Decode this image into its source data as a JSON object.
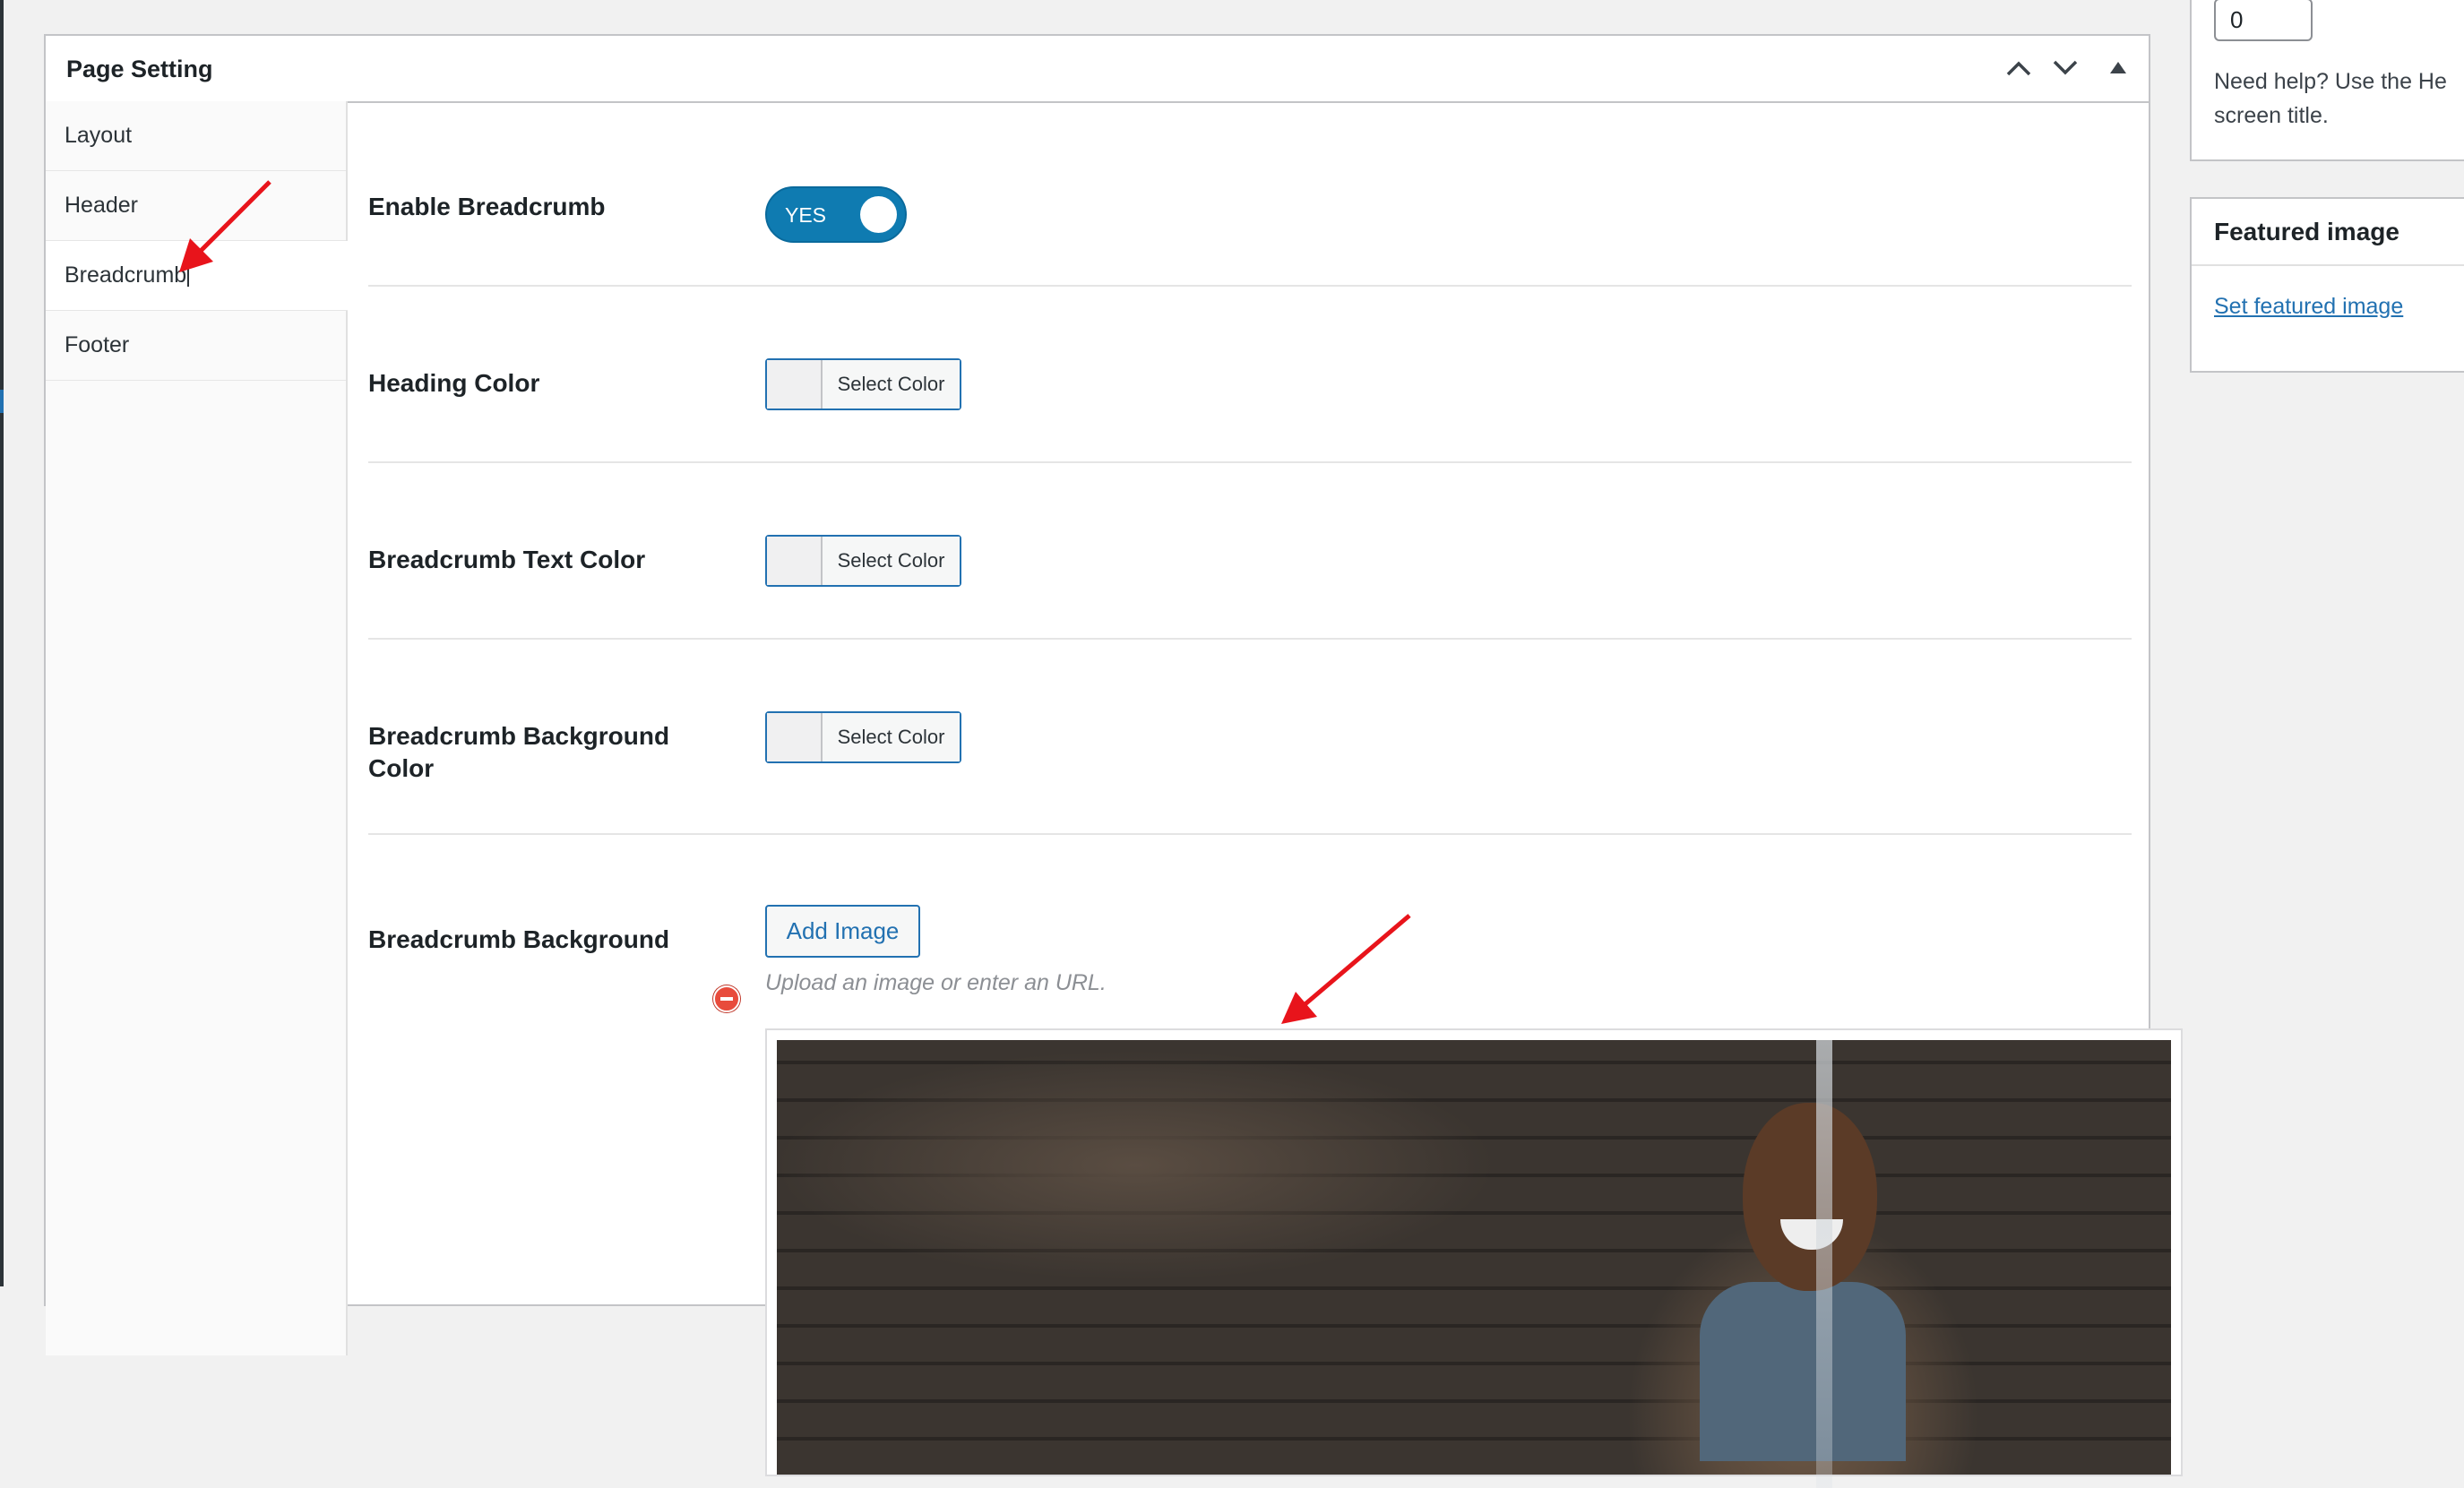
{
  "metabox": {
    "title": "Page Setting",
    "controls": [
      "chevron-up-icon",
      "chevron-down-icon",
      "triangle-up-icon"
    ]
  },
  "tabs": [
    {
      "label": "Layout"
    },
    {
      "label": "Header"
    },
    {
      "label": "Breadcrumb",
      "active": true
    },
    {
      "label": "Footer"
    }
  ],
  "fields": {
    "enable_breadcrumb": {
      "label": "Enable Breadcrumb",
      "toggle_text": "YES",
      "value": true
    },
    "heading_color": {
      "label": "Heading Color",
      "button": "Select Color"
    },
    "breadcrumb_text_color": {
      "label": "Breadcrumb Text Color",
      "button": "Select Color"
    },
    "breadcrumb_background_color": {
      "label": "Breadcrumb Background Color",
      "button": "Select Color"
    },
    "breadcrumb_background": {
      "label": "Breadcrumb Background",
      "add_button": "Add Image",
      "hint": "Upload an image or enter an URL."
    }
  },
  "sidebar": {
    "order": {
      "value": "0"
    },
    "help_line1": "Need help? Use the He",
    "help_line2": "screen title.",
    "featured_image": {
      "title": "Featured image",
      "link": "Set featured image"
    }
  },
  "colors": {
    "accent": "#2271b1",
    "toggle": "#0f7bb1",
    "annotation_arrow": "#e8141b",
    "remove": "#e84b3c"
  }
}
